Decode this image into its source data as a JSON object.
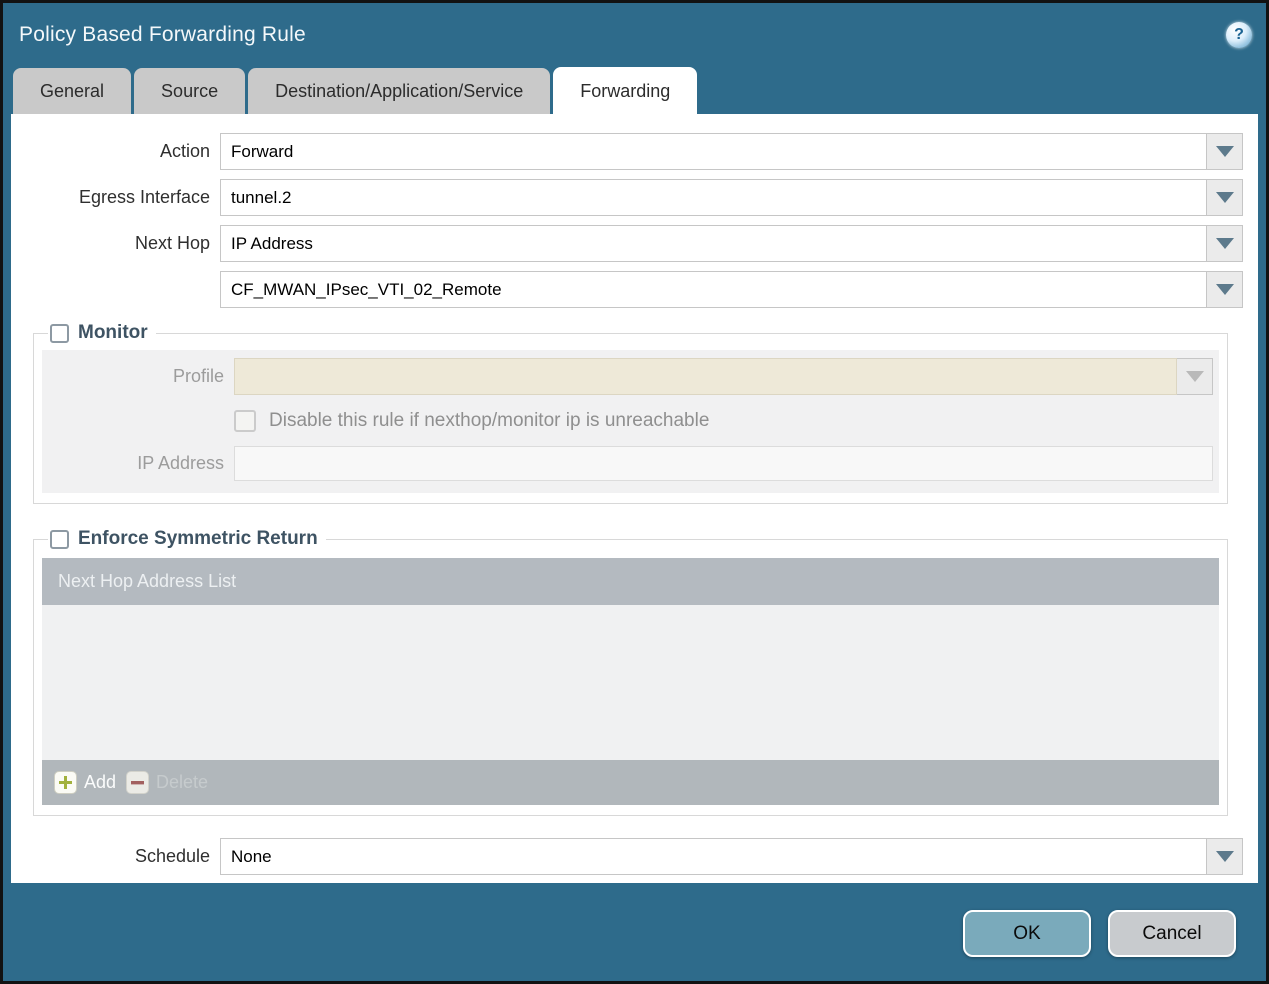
{
  "dialog": {
    "title": "Policy Based Forwarding Rule"
  },
  "icons": {
    "help": "?"
  },
  "tabs": [
    {
      "label": "General",
      "active": false
    },
    {
      "label": "Source",
      "active": false
    },
    {
      "label": "Destination/Application/Service",
      "active": false
    },
    {
      "label": "Forwarding",
      "active": true
    }
  ],
  "form": {
    "action": {
      "label": "Action",
      "value": "Forward"
    },
    "egress_interface": {
      "label": "Egress Interface",
      "value": "tunnel.2"
    },
    "next_hop": {
      "label": "Next Hop",
      "value": "IP Address"
    },
    "next_hop_address": {
      "value": "CF_MWAN_IPsec_VTI_02_Remote"
    },
    "schedule": {
      "label": "Schedule",
      "value": "None"
    }
  },
  "monitor": {
    "title": "Monitor",
    "checked": false,
    "profile": {
      "label": "Profile",
      "value": ""
    },
    "disable_rule_label": "Disable this rule if nexthop/monitor ip is unreachable",
    "disable_rule_checked": false,
    "ip_address": {
      "label": "IP Address",
      "value": ""
    }
  },
  "symmetric_return": {
    "title": "Enforce Symmetric Return",
    "checked": false,
    "table_header": "Next Hop Address List",
    "rows": [],
    "add_label": "Add",
    "delete_label": "Delete"
  },
  "footer": {
    "ok_label": "OK",
    "cancel_label": "Cancel"
  },
  "colors": {
    "titlebar_teal": "#2e6b8b",
    "ok_button": "#7aaabb",
    "cancel_button": "#c8cbce",
    "table_header_bg": "#b4bac0",
    "disabled_profile_bg": "#eee9d8",
    "section_title": "#3e5363"
  }
}
